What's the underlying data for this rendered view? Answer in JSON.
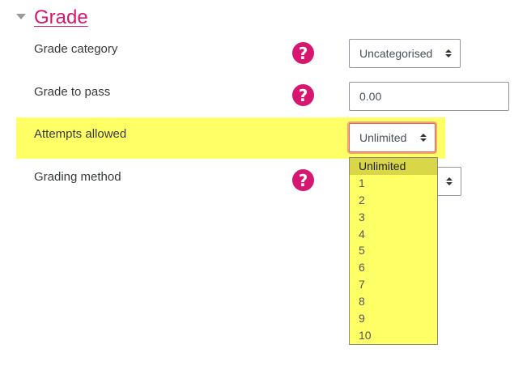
{
  "section": {
    "title": "Grade"
  },
  "rows": {
    "grade_category": {
      "label": "Grade category",
      "value": "Uncategorised"
    },
    "grade_to_pass": {
      "label": "Grade to pass",
      "value": "0.00"
    },
    "attempts_allowed": {
      "label": "Attempts allowed",
      "value": "Unlimited"
    },
    "grading_method": {
      "label": "Grading method"
    }
  },
  "help_icon_glyph": "?",
  "dropdown": {
    "options": [
      "Unlimited",
      "1",
      "2",
      "3",
      "4",
      "5",
      "6",
      "7",
      "8",
      "9",
      "10"
    ],
    "selected_index": 0
  },
  "colors": {
    "accent": "#d6166f",
    "highlight": "#ffff66"
  }
}
